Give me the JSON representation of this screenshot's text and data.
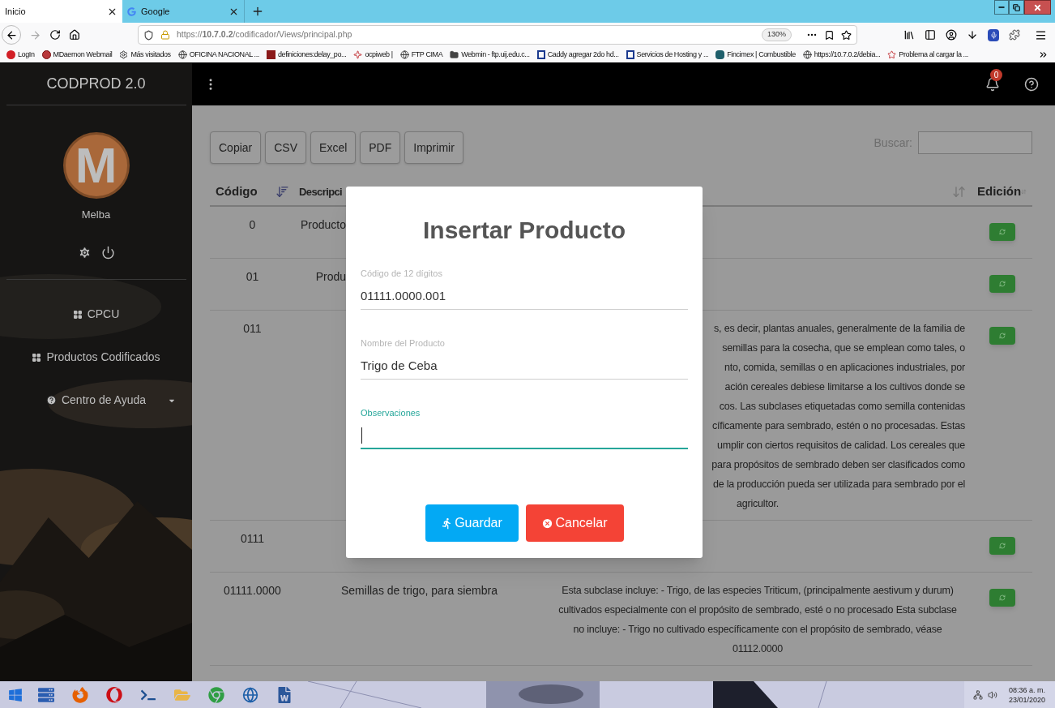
{
  "browser": {
    "tabs": [
      {
        "label": "Inicio",
        "selected": true
      },
      {
        "label": "Google",
        "selected": false
      }
    ],
    "url": "https://**10.7.0.2**/codificador/Views/principal.php",
    "zoom": "130%",
    "bookmarks": [
      "LogIn",
      "MDaemon Webmail",
      "Más visitados",
      "OFICINA NACIONAL ...",
      "definiciones:delay_po...",
      "ocpiweb |",
      "FTP CIMA",
      "Webmin - ftp.uij.edu.c...",
      "Caddy agregar 2do hd...",
      "Servicios de Hosting y ...",
      "Fincimex | Combustible",
      "https://10.7.0.2/debia...",
      "Problema al cargar la ..."
    ]
  },
  "sidebar": {
    "brand": "CODPROD 2.0",
    "user": {
      "initial": "M",
      "name": "Melba"
    },
    "nav": [
      {
        "label": "CPCU",
        "expandable": false
      },
      {
        "label": "Productos Codificados",
        "expandable": false
      },
      {
        "label": "Centro de Ayuda",
        "expandable": true
      }
    ]
  },
  "topbar": {
    "notifications": "0"
  },
  "toolbar": {
    "buttons": [
      "Copiar",
      "CSV",
      "Excel",
      "PDF",
      "Imprimir"
    ],
    "search_label": "Buscar:"
  },
  "table": {
    "columns": [
      "Código",
      "Descripci",
      null,
      "Edición"
    ],
    "rows": [
      {
        "code": "0",
        "description": {
          "text": "Producto",
          "kind": "covered"
        }
      },
      {
        "code": "01",
        "description": {
          "text": "Produ",
          "kind": "covered"
        }
      },
      {
        "code": "011",
        "observation_lines": [
          {
            "text": "s, es decir, plantas anuales, generalmente de la familia de",
            "kind": "cut"
          },
          {
            "text": "semillas para la cosecha, que se emplean como tales, o",
            "kind": "cut"
          },
          {
            "text": "nto, comida, semillas o en aplicaciones industriales, por",
            "kind": "cut"
          },
          {
            "text": "ación cereales debiese limitarse a los cultivos donde se",
            "kind": "cut"
          },
          {
            "text": "cos. Las subclases etiquetadas como semilla contenidas",
            "kind": "cut"
          },
          {
            "text": "cíficamente para sembrado, estén o no procesadas. Estas",
            "kind": "cut"
          },
          {
            "text": "umplir con ciertos requisitos de calidad. Los cereales que",
            "kind": "cut"
          },
          {
            "text": "para propósitos de sembrado deben ser clasificados como",
            "kind": "cut"
          },
          {
            "text": "de la producción pueda ser utilizada para sembrado por el",
            "kind": "cut"
          },
          {
            "text": "agricultor.",
            "kind": "whole"
          }
        ]
      },
      {
        "code": "0111"
      },
      {
        "code": "01111.0000",
        "description": {
          "text": "Semillas de trigo, para siembra",
          "kind": "plain"
        },
        "observations": "Esta subclase incluye: - Trigo, de las especies Triticum, (principalmente aestivum y durum) cultivados especialmente con el propósito de sembrado, esté o no procesado Esta subclase no incluye: - Trigo no cultivado específicamente con el propósito de sembrado, véase 01112.0000"
      }
    ]
  },
  "dialog": {
    "title": "Insertar Producto",
    "fields": [
      {
        "label": "Código de 12 dígitos",
        "value": "01111.0000.001",
        "focused": false
      },
      {
        "label": "Nombre del Producto",
        "value": "Trigo de Ceba",
        "focused": false
      },
      {
        "label": "Observaciones",
        "focused": true
      }
    ],
    "buttons": [
      {
        "label": "Guardar",
        "kind": "primary"
      },
      {
        "label": "Cancelar",
        "kind": "danger"
      }
    ]
  },
  "taskbar": {
    "time": "08:36 a. m.",
    "date": "23/01/2020"
  }
}
